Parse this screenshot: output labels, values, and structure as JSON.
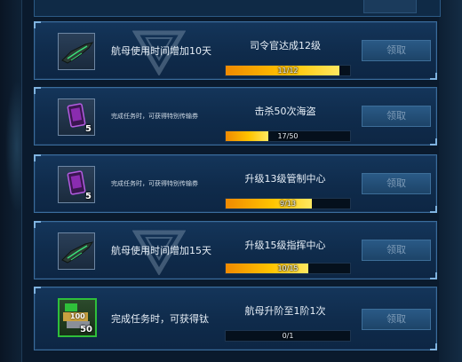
{
  "claim_label": "领取",
  "tasks": [
    {
      "reward_text": "航母使用时间增加10天",
      "reward_icon": "carrier-ship-icon",
      "reward_qty": "",
      "task_title": "司令官达成12级",
      "progress_text": "11/12",
      "progress_fraction": 0.917
    },
    {
      "reward_text": "完成任务时，可获得特别传输券",
      "reward_icon": "transfer-ticket-icon",
      "reward_qty": "5",
      "task_title": "击杀50次海盗",
      "progress_text": "17/50",
      "progress_fraction": 0.34
    },
    {
      "reward_text": "完成任务时，可获得特别传输券",
      "reward_icon": "transfer-ticket-icon",
      "reward_qty": "5",
      "task_title": "升级13级管制中心",
      "progress_text": "9/13",
      "progress_fraction": 0.692
    },
    {
      "reward_text": "航母使用时间增加15天",
      "reward_icon": "carrier-ship-icon",
      "reward_qty": "",
      "task_title": "升级15级指挥中心",
      "progress_text": "10/15",
      "progress_fraction": 0.667
    },
    {
      "reward_text": "完成任务时，可获得钛",
      "reward_icon": "titanium-resource-icon",
      "reward_qty": "50",
      "reward_badge": "100",
      "task_title": "航母升阶至1阶1次",
      "progress_text": "0/1",
      "progress_fraction": 0.0
    }
  ]
}
